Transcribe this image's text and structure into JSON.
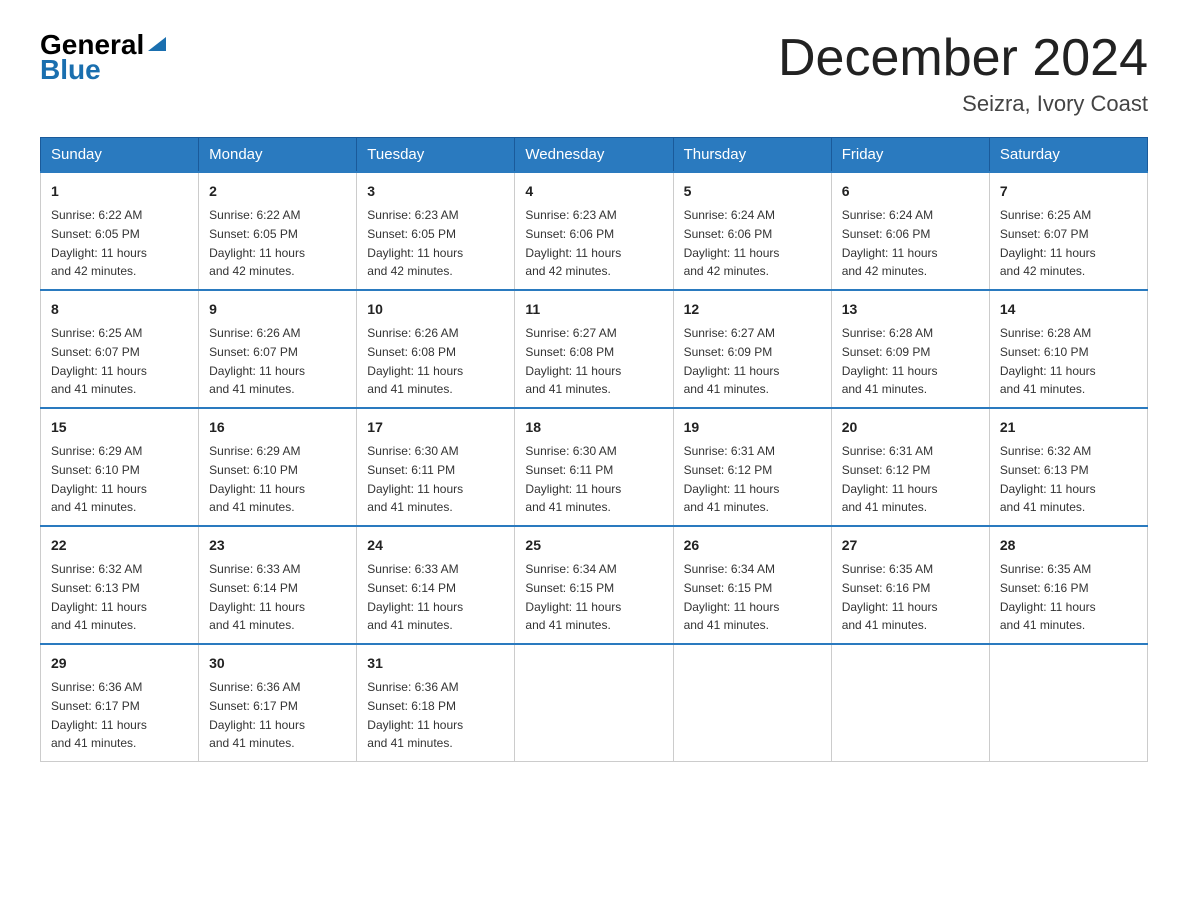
{
  "header": {
    "logo_general": "General",
    "logo_blue": "Blue",
    "month_title": "December 2024",
    "location": "Seizra, Ivory Coast"
  },
  "days_of_week": [
    "Sunday",
    "Monday",
    "Tuesday",
    "Wednesday",
    "Thursday",
    "Friday",
    "Saturday"
  ],
  "weeks": [
    [
      {
        "day": "1",
        "sunrise": "6:22 AM",
        "sunset": "6:05 PM",
        "daylight": "11 hours and 42 minutes."
      },
      {
        "day": "2",
        "sunrise": "6:22 AM",
        "sunset": "6:05 PM",
        "daylight": "11 hours and 42 minutes."
      },
      {
        "day": "3",
        "sunrise": "6:23 AM",
        "sunset": "6:05 PM",
        "daylight": "11 hours and 42 minutes."
      },
      {
        "day": "4",
        "sunrise": "6:23 AM",
        "sunset": "6:06 PM",
        "daylight": "11 hours and 42 minutes."
      },
      {
        "day": "5",
        "sunrise": "6:24 AM",
        "sunset": "6:06 PM",
        "daylight": "11 hours and 42 minutes."
      },
      {
        "day": "6",
        "sunrise": "6:24 AM",
        "sunset": "6:06 PM",
        "daylight": "11 hours and 42 minutes."
      },
      {
        "day": "7",
        "sunrise": "6:25 AM",
        "sunset": "6:07 PM",
        "daylight": "11 hours and 42 minutes."
      }
    ],
    [
      {
        "day": "8",
        "sunrise": "6:25 AM",
        "sunset": "6:07 PM",
        "daylight": "11 hours and 41 minutes."
      },
      {
        "day": "9",
        "sunrise": "6:26 AM",
        "sunset": "6:07 PM",
        "daylight": "11 hours and 41 minutes."
      },
      {
        "day": "10",
        "sunrise": "6:26 AM",
        "sunset": "6:08 PM",
        "daylight": "11 hours and 41 minutes."
      },
      {
        "day": "11",
        "sunrise": "6:27 AM",
        "sunset": "6:08 PM",
        "daylight": "11 hours and 41 minutes."
      },
      {
        "day": "12",
        "sunrise": "6:27 AM",
        "sunset": "6:09 PM",
        "daylight": "11 hours and 41 minutes."
      },
      {
        "day": "13",
        "sunrise": "6:28 AM",
        "sunset": "6:09 PM",
        "daylight": "11 hours and 41 minutes."
      },
      {
        "day": "14",
        "sunrise": "6:28 AM",
        "sunset": "6:10 PM",
        "daylight": "11 hours and 41 minutes."
      }
    ],
    [
      {
        "day": "15",
        "sunrise": "6:29 AM",
        "sunset": "6:10 PM",
        "daylight": "11 hours and 41 minutes."
      },
      {
        "day": "16",
        "sunrise": "6:29 AM",
        "sunset": "6:10 PM",
        "daylight": "11 hours and 41 minutes."
      },
      {
        "day": "17",
        "sunrise": "6:30 AM",
        "sunset": "6:11 PM",
        "daylight": "11 hours and 41 minutes."
      },
      {
        "day": "18",
        "sunrise": "6:30 AM",
        "sunset": "6:11 PM",
        "daylight": "11 hours and 41 minutes."
      },
      {
        "day": "19",
        "sunrise": "6:31 AM",
        "sunset": "6:12 PM",
        "daylight": "11 hours and 41 minutes."
      },
      {
        "day": "20",
        "sunrise": "6:31 AM",
        "sunset": "6:12 PM",
        "daylight": "11 hours and 41 minutes."
      },
      {
        "day": "21",
        "sunrise": "6:32 AM",
        "sunset": "6:13 PM",
        "daylight": "11 hours and 41 minutes."
      }
    ],
    [
      {
        "day": "22",
        "sunrise": "6:32 AM",
        "sunset": "6:13 PM",
        "daylight": "11 hours and 41 minutes."
      },
      {
        "day": "23",
        "sunrise": "6:33 AM",
        "sunset": "6:14 PM",
        "daylight": "11 hours and 41 minutes."
      },
      {
        "day": "24",
        "sunrise": "6:33 AM",
        "sunset": "6:14 PM",
        "daylight": "11 hours and 41 minutes."
      },
      {
        "day": "25",
        "sunrise": "6:34 AM",
        "sunset": "6:15 PM",
        "daylight": "11 hours and 41 minutes."
      },
      {
        "day": "26",
        "sunrise": "6:34 AM",
        "sunset": "6:15 PM",
        "daylight": "11 hours and 41 minutes."
      },
      {
        "day": "27",
        "sunrise": "6:35 AM",
        "sunset": "6:16 PM",
        "daylight": "11 hours and 41 minutes."
      },
      {
        "day": "28",
        "sunrise": "6:35 AM",
        "sunset": "6:16 PM",
        "daylight": "11 hours and 41 minutes."
      }
    ],
    [
      {
        "day": "29",
        "sunrise": "6:36 AM",
        "sunset": "6:17 PM",
        "daylight": "11 hours and 41 minutes."
      },
      {
        "day": "30",
        "sunrise": "6:36 AM",
        "sunset": "6:17 PM",
        "daylight": "11 hours and 41 minutes."
      },
      {
        "day": "31",
        "sunrise": "6:36 AM",
        "sunset": "6:18 PM",
        "daylight": "11 hours and 41 minutes."
      },
      null,
      null,
      null,
      null
    ]
  ],
  "labels": {
    "sunrise": "Sunrise:",
    "sunset": "Sunset:",
    "daylight": "Daylight:"
  }
}
